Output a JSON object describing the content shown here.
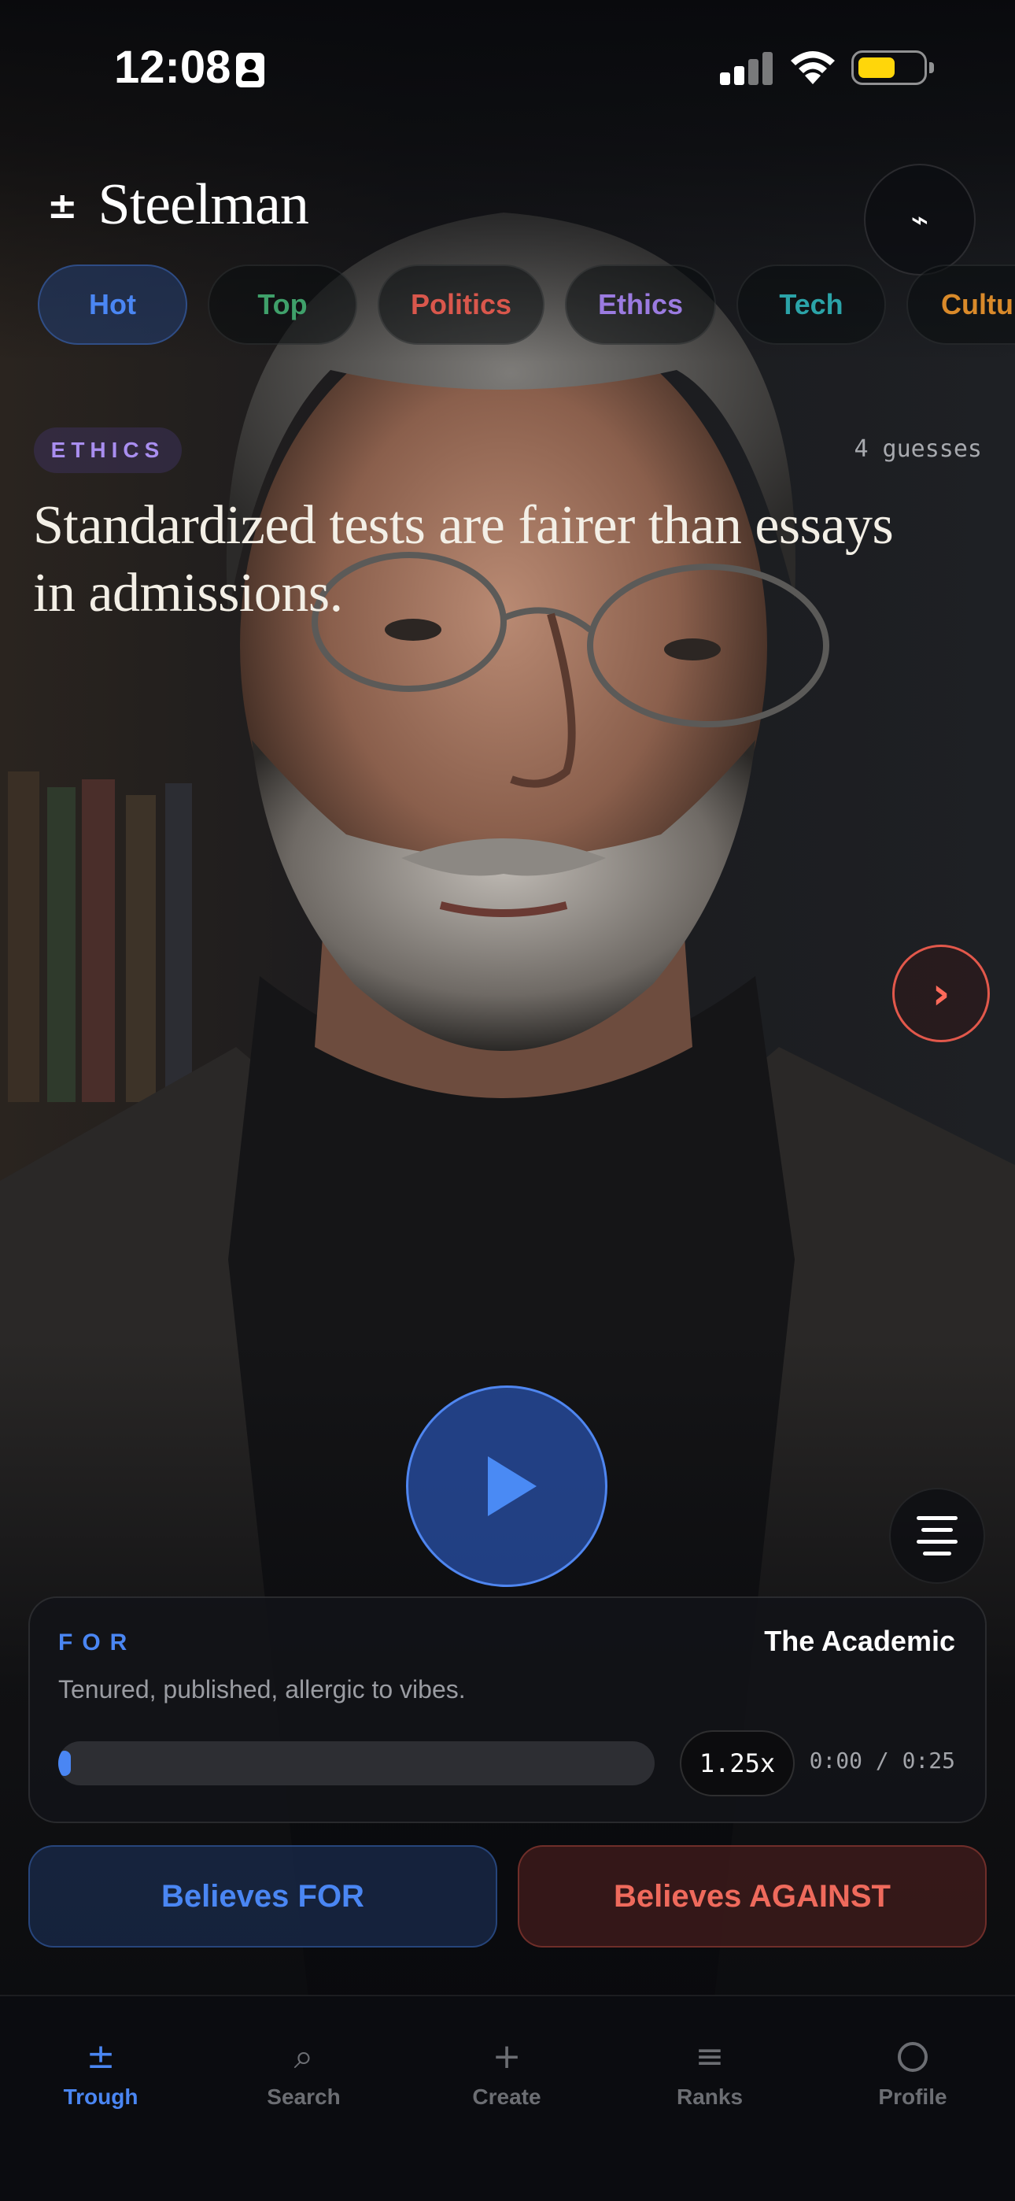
{
  "status_bar": {
    "time": "12:08"
  },
  "app": {
    "logo_symbol": "±",
    "title": "Steelman",
    "bolt_icon": "⌁"
  },
  "categories": [
    {
      "label": "Hot",
      "color": "#4a86f3",
      "selected": true
    },
    {
      "label": "Top",
      "color": "#3fa06a",
      "selected": false
    },
    {
      "label": "Politics",
      "color": "#d9574c",
      "selected": false
    },
    {
      "label": "Ethics",
      "color": "#9b7be0",
      "selected": false
    },
    {
      "label": "Tech",
      "color": "#2ba3a8",
      "selected": false
    },
    {
      "label": "Culture",
      "color": "#d98a2a",
      "selected": false
    }
  ],
  "topic": {
    "category": "ETHICS",
    "guesses": "4 guesses",
    "statement": "Standardized tests are fairer than essays in admissions."
  },
  "navigation": {
    "next_icon": "›"
  },
  "player": {
    "side": "FOR",
    "persona": "The Academic",
    "tagline": "Tenured, published, allergic to vibes.",
    "speed": "1.25x",
    "time": "0:00 / 0:25",
    "progress": 0
  },
  "votes": {
    "for_label": "Believes FOR",
    "against_label": "Believes AGAINST"
  },
  "tabbar": [
    {
      "label": "Trough",
      "icon": "±",
      "active": true
    },
    {
      "label": "Search",
      "icon": "⌕",
      "active": false
    },
    {
      "label": "Create",
      "icon": "+",
      "active": false
    },
    {
      "label": "Ranks",
      "icon": "≡",
      "active": false
    },
    {
      "label": "Profile",
      "icon": "",
      "active": false
    }
  ],
  "colors": {
    "accent_for": "#4a86f3",
    "accent_against": "#e2584b",
    "background": "#07080b"
  }
}
